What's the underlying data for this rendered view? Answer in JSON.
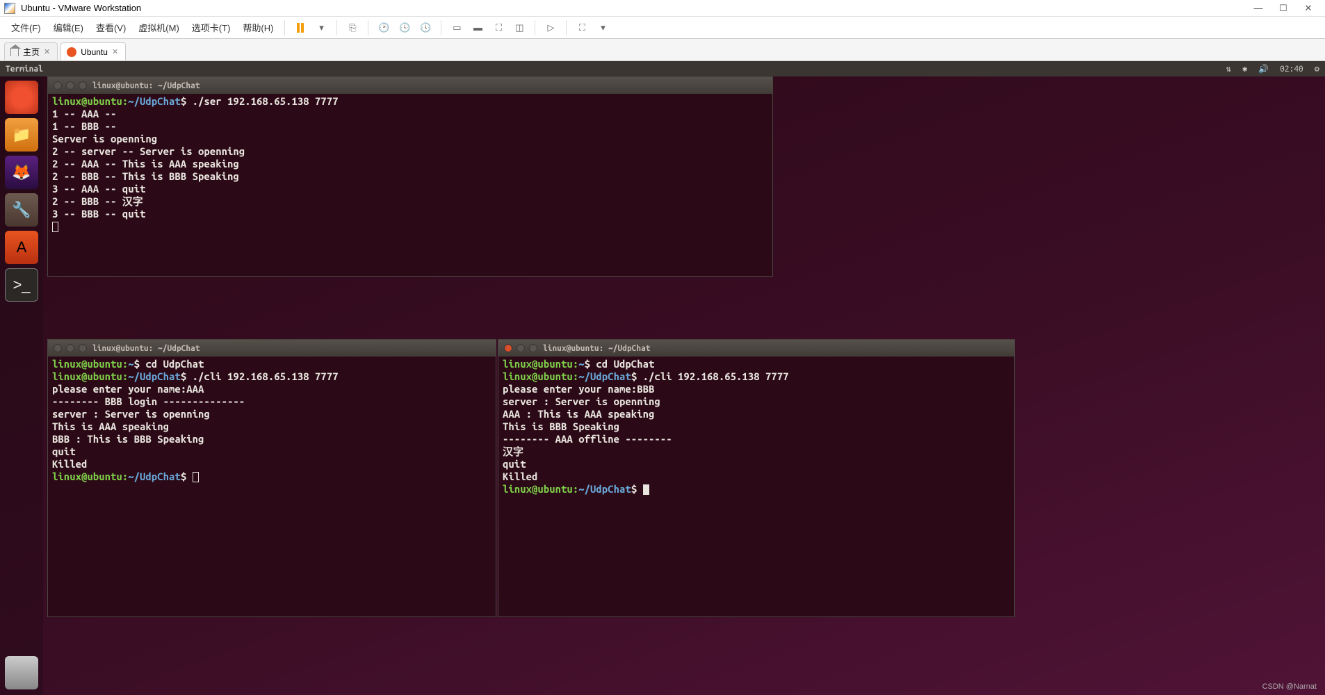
{
  "window": {
    "title": "Ubuntu - VMware Workstation"
  },
  "menu": {
    "items": [
      "文件(F)",
      "编辑(E)",
      "查看(V)",
      "虚拟机(M)",
      "选项卡(T)",
      "帮助(H)"
    ]
  },
  "tabs": {
    "home": "主页",
    "active": "Ubuntu"
  },
  "ubuntu": {
    "topbar_title": "Terminal",
    "clock": "02:40"
  },
  "terminals": [
    {
      "title": "linux@ubuntu: ~/UdpChat",
      "active_close": false,
      "lines": [
        {
          "prompt": "linux@ubuntu:~/UdpChat$",
          "text": " ./ser 192.168.65.138 7777"
        },
        {
          "text": "1 -- AAA --"
        },
        {
          "text": "1 -- BBB --"
        },
        {
          "text": "Server is openning"
        },
        {
          "text": "2 -- server -- Server is openning"
        },
        {
          "text": "2 -- AAA -- This is AAA speaking"
        },
        {
          "text": "2 -- BBB -- This is BBB Speaking"
        },
        {
          "text": "3 -- AAA -- quit"
        },
        {
          "text": "2 -- BBB -- 汉字"
        },
        {
          "text": "3 -- BBB -- quit"
        }
      ],
      "trailing_cursor": true,
      "cursor_solid": false
    },
    {
      "title": "linux@ubuntu: ~/UdpChat",
      "active_close": false,
      "lines": [
        {
          "prompt": "linux@ubuntu:~$",
          "text": " cd UdpChat"
        },
        {
          "prompt": "linux@ubuntu:~/UdpChat$",
          "text": " ./cli 192.168.65.138 7777"
        },
        {
          "text": "please enter your name:AAA"
        },
        {
          "text": "-------- BBB login --------------"
        },
        {
          "text": "server : Server is openning"
        },
        {
          "text": "This is AAA speaking"
        },
        {
          "text": "BBB : This is BBB Speaking"
        },
        {
          "text": "quit"
        },
        {
          "text": "Killed"
        },
        {
          "prompt": "linux@ubuntu:~/UdpChat$",
          "text": " ",
          "inline_cursor": true,
          "cursor_solid": false
        }
      ]
    },
    {
      "title": "linux@ubuntu: ~/UdpChat",
      "active_close": true,
      "lines": [
        {
          "prompt": "linux@ubuntu:~$",
          "text": " cd UdpChat"
        },
        {
          "prompt": "linux@ubuntu:~/UdpChat$",
          "text": " ./cli 192.168.65.138 7777"
        },
        {
          "text": "please enter your name:BBB"
        },
        {
          "text": "server : Server is openning"
        },
        {
          "text": "AAA : This is AAA speaking"
        },
        {
          "text": "This is BBB Speaking"
        },
        {
          "text": "-------- AAA offline --------"
        },
        {
          "text": "汉字"
        },
        {
          "text": "quit"
        },
        {
          "text": "Killed"
        },
        {
          "prompt": "linux@ubuntu:~/UdpChat$",
          "text": " ",
          "inline_cursor": true,
          "cursor_solid": true
        }
      ]
    }
  ],
  "watermark": "CSDN @Narnat"
}
